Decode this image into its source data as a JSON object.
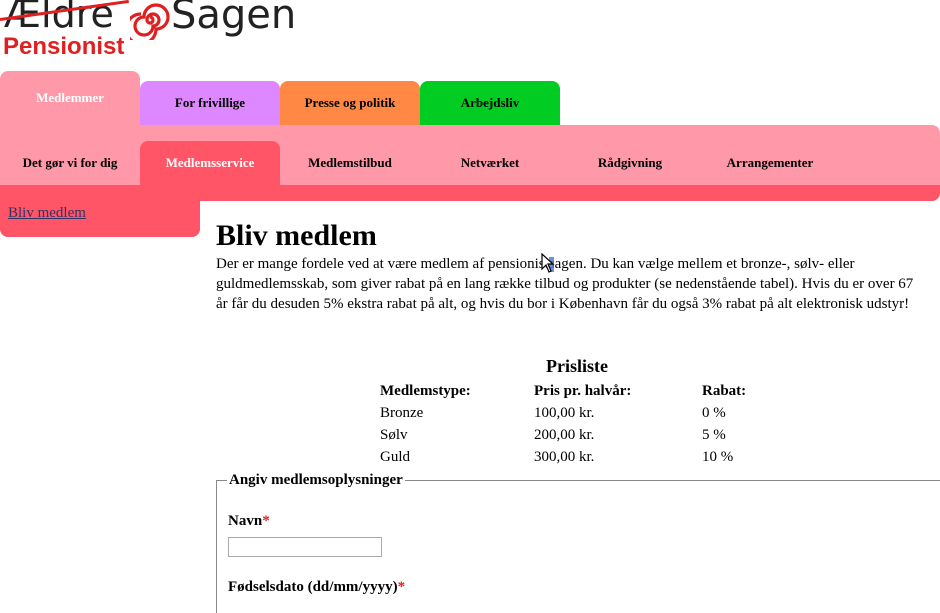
{
  "logo": {
    "old_name": "Ældre",
    "new_name": "Sagen",
    "subtitle": "Pensionist",
    "accent_color": "#e02020"
  },
  "top_tabs": [
    {
      "label": "Medlemmer",
      "color": "#ff99aa",
      "active": true
    },
    {
      "label": "For frivillige",
      "color": "#dd88ff"
    },
    {
      "label": "Presse og politik",
      "color": "#ff8844"
    },
    {
      "label": "Arbejdsliv",
      "color": "#00cc22"
    }
  ],
  "sub_nav": [
    {
      "label": "Det gør vi for dig"
    },
    {
      "label": "Medlemsservice",
      "active": true
    },
    {
      "label": "Medlemstilbud"
    },
    {
      "label": "Netværket"
    },
    {
      "label": "Rådgivning"
    },
    {
      "label": "Arrangementer"
    }
  ],
  "sidebar": {
    "link": "Bliv medlem"
  },
  "main": {
    "title": "Bliv medlem",
    "intro": "Der er mange fordele ved at være medlem af pensionistsagen. Du kan vælge mellem et bronze-, sølv- eller guldmedlemsskab, som giver rabat på en lang række tilbud og produkter (se nedenstående tabel). Hvis du er over 67 år får du desuden 5% ekstra rabat på alt, og hvis du bor i København får du også 3% rabat på alt elektronisk udstyr!"
  },
  "price_list": {
    "title": "Prisliste",
    "headers": [
      "Medlemstype:",
      "Pris pr. halvår:",
      "Rabat:"
    ],
    "rows": [
      [
        "Bronze",
        "100,00 kr.",
        "0 %"
      ],
      [
        "Sølv",
        "200,00 kr.",
        "5 %"
      ],
      [
        "Guld",
        "300,00 kr.",
        "10 %"
      ]
    ]
  },
  "form": {
    "legend": "Angiv medlemsoplysninger",
    "name_label": "Navn",
    "name_value": "",
    "birthdate_label": "Fødselsdato (dd/mm/yyyy)",
    "required_marker": "*"
  }
}
